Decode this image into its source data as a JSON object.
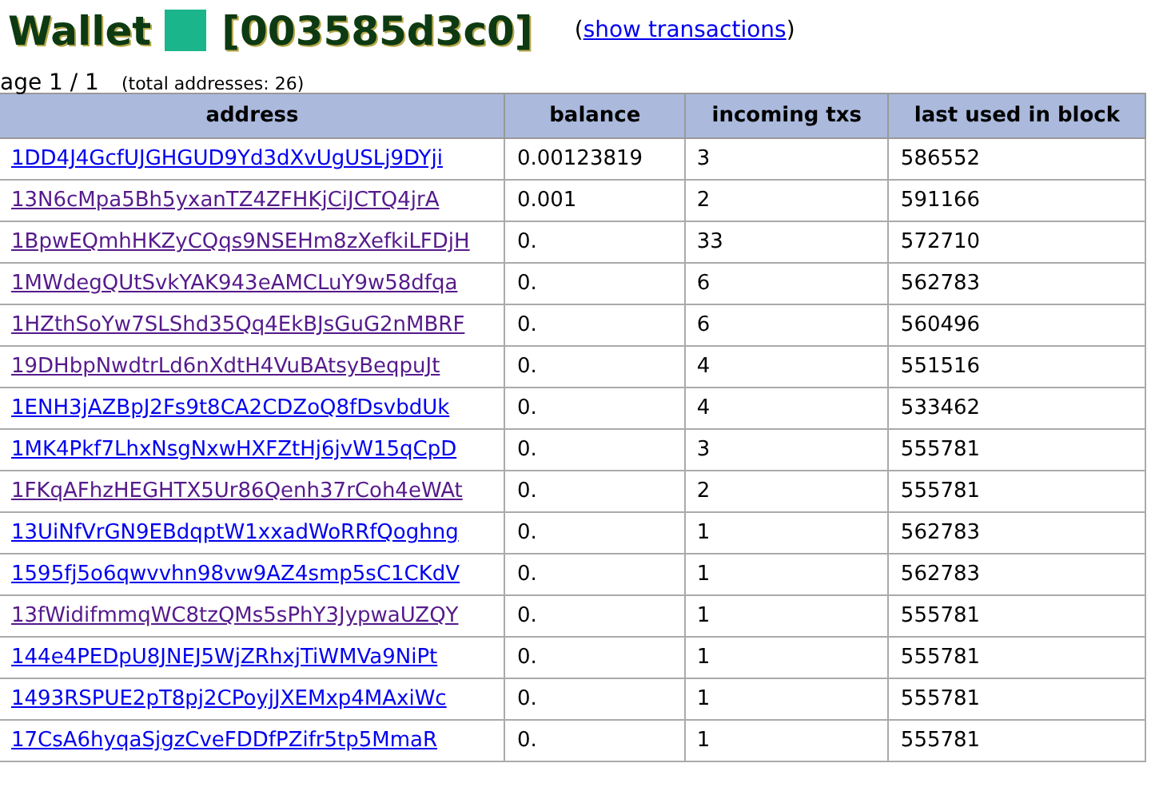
{
  "heading": {
    "title": "Wallet",
    "color": "#1ab58a",
    "id": "[003585d3c0]",
    "link_open": "(",
    "link": "show transactions",
    "link_close": ")"
  },
  "pager": {
    "page": "age 1 / 1",
    "total": "(total addresses: 26)"
  },
  "table": {
    "columns": [
      "address",
      "balance",
      "incoming txs",
      "last used in block"
    ],
    "rows": [
      {
        "address": "1DD4J4GcfUJGHGUD9Yd3dXvUgUSLj9DYji",
        "visited": false,
        "balance": "0.00123819",
        "incoming": "3",
        "block": "586552"
      },
      {
        "address": "13N6cMpa5Bh5yxanTZ4ZFHKjCiJCTQ4jrA",
        "visited": true,
        "balance": "0.001",
        "incoming": "2",
        "block": "591166"
      },
      {
        "address": "1BpwEQmhHKZyCQqs9NSEHm8zXefkiLFDjH",
        "visited": true,
        "balance": "0.",
        "incoming": "33",
        "block": "572710"
      },
      {
        "address": "1MWdegQUtSvkYAK943eAMCLuY9w58dfqa",
        "visited": true,
        "balance": "0.",
        "incoming": "6",
        "block": "562783"
      },
      {
        "address": "1HZthSoYw7SLShd35Qq4EkBJsGuG2nMBRF",
        "visited": true,
        "balance": "0.",
        "incoming": "6",
        "block": "560496"
      },
      {
        "address": "19DHbpNwdtrLd6nXdtH4VuBAtsyBeqpuJt",
        "visited": true,
        "balance": "0.",
        "incoming": "4",
        "block": "551516"
      },
      {
        "address": "1ENH3jAZBpJ2Fs9t8CA2CDZoQ8fDsvbdUk",
        "visited": false,
        "balance": "0.",
        "incoming": "4",
        "block": "533462"
      },
      {
        "address": "1MK4Pkf7LhxNsgNxwHXFZtHj6jvW15qCpD",
        "visited": false,
        "balance": "0.",
        "incoming": "3",
        "block": "555781"
      },
      {
        "address": "1FKqAFhzHEGHTX5Ur86Qenh37rCoh4eWAt",
        "visited": true,
        "balance": "0.",
        "incoming": "2",
        "block": "555781"
      },
      {
        "address": "13UiNfVrGN9EBdqptW1xxadWoRRfQoghng",
        "visited": false,
        "balance": "0.",
        "incoming": "1",
        "block": "562783"
      },
      {
        "address": "1595fj5o6qwvvhn98vw9AZ4smp5sC1CKdV",
        "visited": false,
        "balance": "0.",
        "incoming": "1",
        "block": "562783"
      },
      {
        "address": "13fWidifmmqWC8tzQMs5sPhY3JypwaUZQY",
        "visited": true,
        "balance": "0.",
        "incoming": "1",
        "block": "555781"
      },
      {
        "address": "144e4PEDpU8JNEJ5WjZRhxjTiWMVa9NiPt",
        "visited": false,
        "balance": "0.",
        "incoming": "1",
        "block": "555781"
      },
      {
        "address": "1493RSPUE2pT8pj2CPoyjJXEMxp4MAxiWc",
        "visited": false,
        "balance": "0.",
        "incoming": "1",
        "block": "555781"
      },
      {
        "address": "17CsA6hyqaSjgzCveFDDfPZifr5tp5MmaR",
        "visited": false,
        "balance": "0.",
        "incoming": "1",
        "block": "555781"
      }
    ]
  }
}
